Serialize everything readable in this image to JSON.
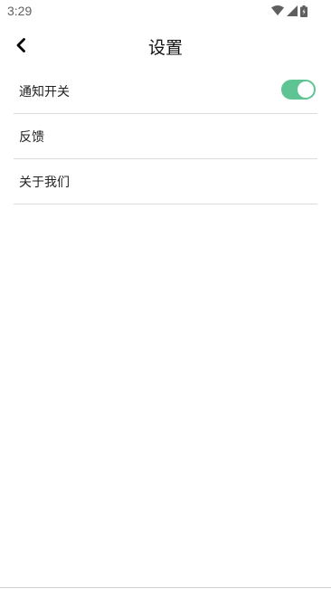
{
  "status_bar": {
    "time": "3:29",
    "icons": [
      "wifi-icon",
      "signal-icon",
      "battery-icon"
    ]
  },
  "header": {
    "title": "设置",
    "back_icon": "chevron-left-icon"
  },
  "settings": {
    "items": [
      {
        "label": "通知开关",
        "toggle_on": true
      },
      {
        "label": "反馈"
      },
      {
        "label": "关于我们"
      }
    ]
  },
  "colors": {
    "toggle_on": "#5ec493",
    "divider": "#dcdcdc"
  }
}
